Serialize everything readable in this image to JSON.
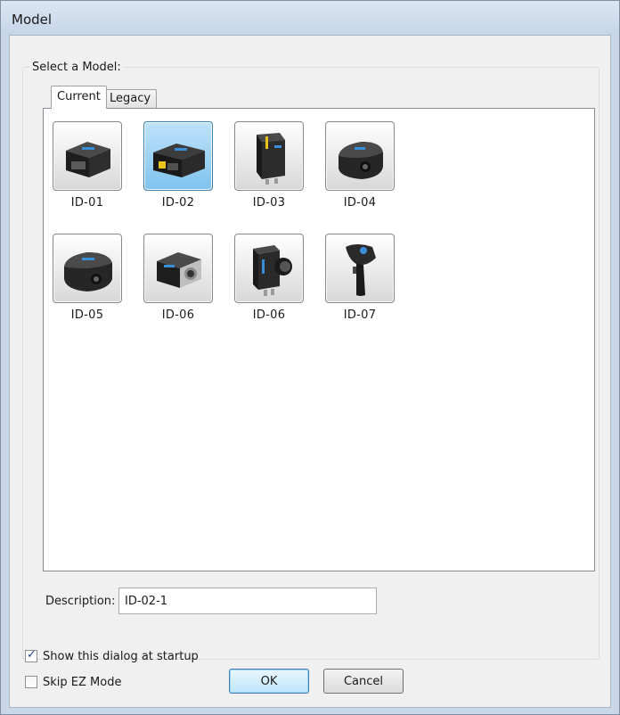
{
  "window": {
    "title": "Model"
  },
  "group": {
    "legend": "Select a Model:"
  },
  "tabs": [
    {
      "label": "Current",
      "active": true
    },
    {
      "label": "Legacy",
      "active": false
    }
  ],
  "models": [
    {
      "label": "ID-01",
      "icon": "scanner-box-icon",
      "selected": false
    },
    {
      "label": "ID-02",
      "icon": "scanner-box-icon",
      "selected": true
    },
    {
      "label": "ID-03",
      "icon": "scanner-vertical-icon",
      "selected": false
    },
    {
      "label": "ID-04",
      "icon": "scanner-dome-icon",
      "selected": false
    },
    {
      "label": "ID-05",
      "icon": "scanner-dome-icon",
      "selected": false
    },
    {
      "label": "ID-06",
      "icon": "camera-cube-icon",
      "selected": false
    },
    {
      "label": "ID-06",
      "icon": "camera-lens-icon",
      "selected": false
    },
    {
      "label": "ID-07",
      "icon": "handheld-scanner-icon",
      "selected": false
    }
  ],
  "description": {
    "label": "Description:",
    "value": "ID-02-1"
  },
  "options": {
    "show_at_startup": {
      "label": "Show this dialog at startup",
      "checked": true
    },
    "skip_ez_mode": {
      "label": "Skip EZ Mode",
      "checked": false
    }
  },
  "buttons": {
    "ok": "OK",
    "cancel": "Cancel"
  },
  "colors": {
    "selection": "#7ec3ee",
    "accent": "#3c7fb1"
  }
}
